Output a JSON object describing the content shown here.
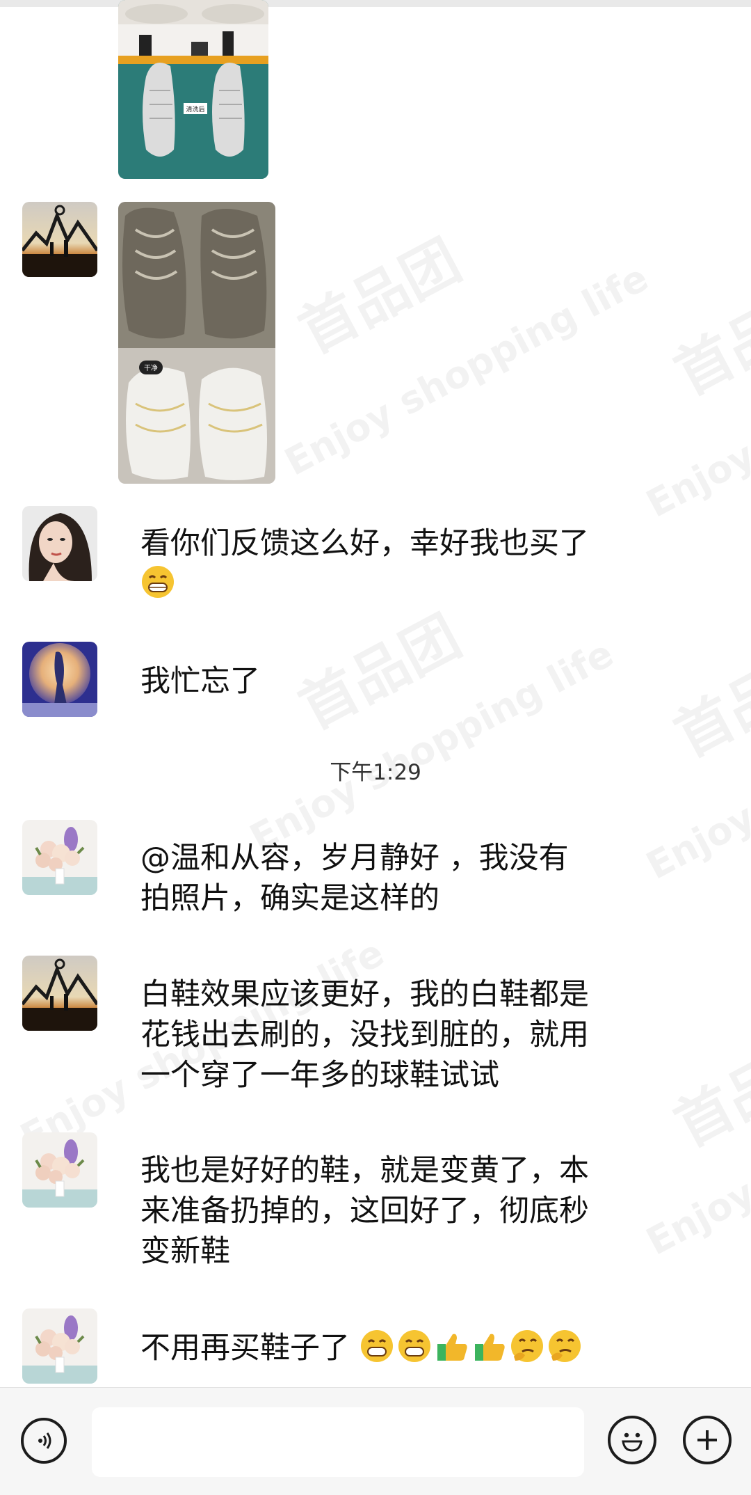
{
  "watermark": {
    "brand": "首品团",
    "slogan": "Enjoy shopping life"
  },
  "messages": [
    {
      "sender_avatar": "sunset-silhouette",
      "type": "image",
      "content": "shoe-before-after-photo",
      "image_caption": "清洗后"
    },
    {
      "sender_avatar": "sunset-silhouette",
      "type": "image",
      "content": "dirty-sneakers-before-after-photo",
      "image_caption": "干净"
    },
    {
      "sender_avatar": "woman-portrait",
      "type": "text",
      "text": "看你们反馈这么好，幸好我也买了",
      "emojis": [
        "grin"
      ]
    },
    {
      "sender_avatar": "moon-silhouette",
      "type": "text",
      "text": "我忙忘了"
    },
    {
      "sender_avatar": "flower-bouquet",
      "type": "text",
      "text_lines": [
        "@温和从容，岁月静好 ，我没有",
        "拍照片，确实是这样的"
      ]
    },
    {
      "sender_avatar": "sunset-silhouette",
      "type": "text",
      "text_lines": [
        "白鞋效果应该更好，我的白鞋都是",
        "花钱出去刷的，没找到脏的，就用",
        "一个穿了一年多的球鞋试试"
      ]
    },
    {
      "sender_avatar": "flower-bouquet",
      "type": "text",
      "text_lines": [
        "我也是好好的鞋，就是变黄了，本",
        "来准备扔掉的，这回好了，彻底秒",
        "变新鞋"
      ]
    },
    {
      "sender_avatar": "flower-bouquet",
      "type": "text",
      "text": "不用再买鞋子了",
      "emojis": [
        "grin",
        "grin",
        "thumbs-up",
        "thumbs-up",
        "thinking",
        "thinking"
      ]
    }
  ],
  "timestamp": "下午1:29",
  "input_bar": {
    "voice_icon": "voice-icon",
    "input_value": "",
    "emoji_icon": "smiley-icon",
    "more_icon": "plus-icon"
  },
  "colors": {
    "background": "#ffffff",
    "input_bar_bg": "#f6f6f6",
    "text": "#111111",
    "emoji_yellow": "#f6c431",
    "thumb_yellow": "#f2b72a",
    "thumb_green": "#3cb45e"
  }
}
